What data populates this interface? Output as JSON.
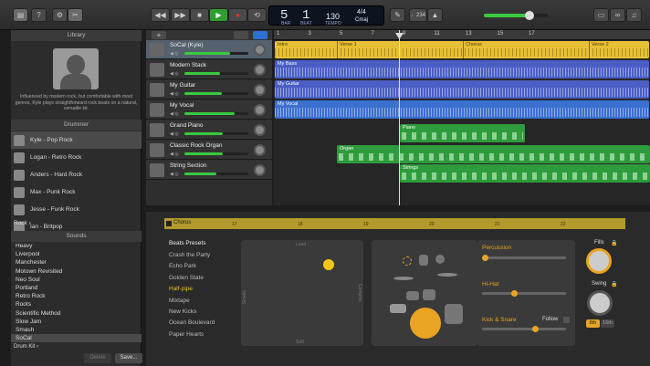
{
  "toolbar": {
    "lcd": {
      "bar": "5",
      "beat": "1",
      "bar_label": "BAR",
      "beat_label": "BEAT",
      "tempo": "130",
      "tempo_label": "TEMPO",
      "sig": "4/4",
      "key": "Cmaj"
    },
    "tuner": "♩234"
  },
  "library": {
    "title": "Library",
    "description": "Influenced by modern rock, but comfortable with most genres, Kyle plays straightforward rock beats on a natural, versatile kit.",
    "drummer_header": "Drummer",
    "drummers": [
      "Kyle - Pop Rock",
      "Logan - Retro Rock",
      "Anders - Hard Rock",
      "Max - Punk Rock",
      "Jesse - Funk Rock",
      "Ian - Britpop"
    ],
    "genre": "Rock",
    "sounds_header": "Sounds",
    "sounds": [
      "Heavy",
      "Liverpool",
      "Manchester",
      "Motown Revisited",
      "Neo Soul",
      "Portland",
      "Retro Rock",
      "Roots",
      "Scientific Method",
      "Slow Jam",
      "Smash",
      "SoCal"
    ],
    "footer": {
      "category": "Drum Kit",
      "delete": "Delete",
      "save": "Save..."
    }
  },
  "tracks": [
    {
      "name": "SoCal (Kyle)",
      "fader": 0.72
    },
    {
      "name": "Modern Stack",
      "fader": 0.55
    },
    {
      "name": "My Guitar",
      "fader": 0.58
    },
    {
      "name": "My Vocal",
      "fader": 0.78
    },
    {
      "name": "Grand Piano",
      "fader": 0.6
    },
    {
      "name": "Classic Rock Organ",
      "fader": 0.6
    },
    {
      "name": "String Section",
      "fader": 0.5
    }
  ],
  "ruler": [
    "1",
    "3",
    "5",
    "7",
    "9",
    "11",
    "13",
    "15",
    "17"
  ],
  "regions": {
    "drummer": [
      "Intro",
      "Verse 1",
      "Chorus",
      "Verse 2"
    ],
    "bass": "My Bass",
    "guitar": "My Guitar",
    "vocal": "My Vocal",
    "piano": "Piano",
    "organ": "Organ",
    "strings": "Strings"
  },
  "smart": {
    "region": "Chorus",
    "bar_numbers": [
      "17",
      "18",
      "19",
      "20",
      "21",
      "22"
    ],
    "presets_header": "Beats Presets",
    "presets": [
      "Crash the Party",
      "Echo Park",
      "Golden State",
      "Half-pipe",
      "Mixtape",
      "New Kicks",
      "Ocean Boulevard",
      "Paper Hearts"
    ],
    "pad": {
      "loud": "Loud",
      "soft": "Soft",
      "simple": "Simple",
      "complex": "Complex"
    },
    "percussion": "Percussion",
    "hihat": "Hi-Hat",
    "kick_snare": "Kick & Snare",
    "follow": "Follow",
    "fills": "Fills",
    "swing": "Swing",
    "swing_8": "8th",
    "swing_16": "16th",
    "levels": {
      "percussion": 0.05,
      "hihat": 0.35,
      "kick_snare": 0.6
    }
  },
  "colors": {
    "accent": "#e8a422",
    "green": "#39c93f",
    "drummer_region": "#e8c036"
  }
}
